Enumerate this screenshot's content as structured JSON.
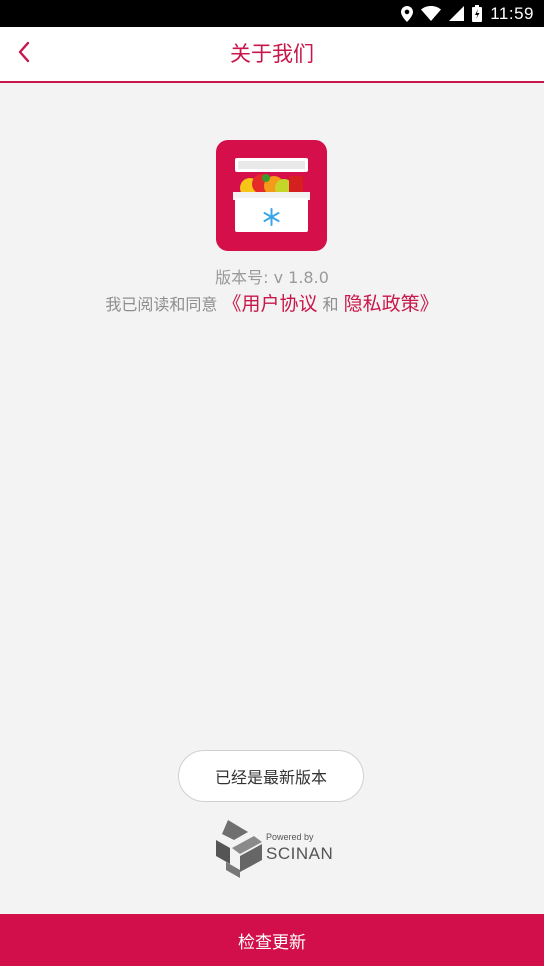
{
  "status_bar": {
    "time": "11:59",
    "icons": [
      "location-icon",
      "wifi-icon",
      "signal-icon",
      "battery-icon"
    ]
  },
  "header": {
    "title": "关于我们",
    "back_icon": "chevron-left-icon"
  },
  "about": {
    "version": "版本号: v 1.8.0",
    "agreement_prefix": "我已阅读和同意 ",
    "user_agreement_link": "《用户协议",
    "and_text": " 和 ",
    "privacy_policy_link": "隐私政策》"
  },
  "latest_button": {
    "label": "已经是最新版本"
  },
  "powered": {
    "line1": "Powered by",
    "brand": "SCINAN"
  },
  "bottom_button": {
    "label": "检查更新"
  },
  "colors": {
    "accent": "#c8174b",
    "button_bg": "#d20f4b",
    "background": "#f3f3f3"
  }
}
